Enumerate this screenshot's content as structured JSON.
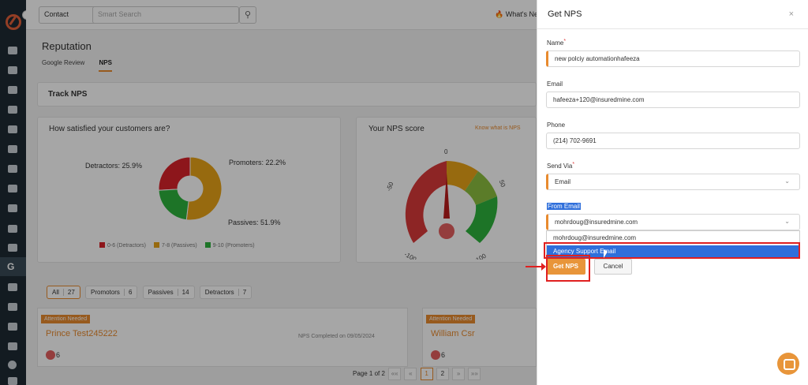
{
  "topbar": {
    "contact_select": "Contact",
    "search_placeholder": "Smart Search",
    "whats_new": "What's Ne"
  },
  "page": {
    "title": "Reputation",
    "tabs": [
      {
        "label": "Google Review",
        "active": false
      },
      {
        "label": "NPS",
        "active": true
      }
    ]
  },
  "track": {
    "title": "Track NPS"
  },
  "satisfaction": {
    "title": "How satisfied your customers are?",
    "legend": [
      {
        "label": "0-6 (Detractors)",
        "color": "#d9232a"
      },
      {
        "label": "7-8 (Passives)",
        "color": "#e8a317"
      },
      {
        "label": "9-10 (Promoters)",
        "color": "#2db33c"
      }
    ]
  },
  "chart_data": {
    "type": "pie",
    "title": "How satisfied your customers are?",
    "categories": [
      "Detractors",
      "Passives",
      "Promoters"
    ],
    "values": [
      25.9,
      51.9,
      22.2
    ],
    "labels": [
      "Detractors: 25.9%",
      "Passives: 51.9%",
      "Promoters: 22.2%"
    ],
    "colors": [
      "#d9232a",
      "#e8a317",
      "#2db33c"
    ]
  },
  "nps_score": {
    "title": "Your NPS score",
    "know_link": "Know what is NPS",
    "value": "-4",
    "ticks": [
      "-100",
      "-50",
      "0",
      "50",
      "100"
    ],
    "segments": [
      "Needs Improvement",
      "Good",
      "Great",
      "Excellent"
    ]
  },
  "filters": [
    {
      "label": "All",
      "count": "27",
      "active": true
    },
    {
      "label": "Promotors",
      "count": "6",
      "active": false
    },
    {
      "label": "Passives",
      "count": "14",
      "active": false
    },
    {
      "label": "Detractors",
      "count": "7",
      "active": false
    }
  ],
  "attention_cards": [
    {
      "badge": "Attention Needed",
      "name": "Prince Test245222",
      "count": "6",
      "completed": "NPS Completed on 09/05/2024"
    },
    {
      "badge": "Attention Needed",
      "name": "William Csr",
      "count": "6",
      "completed": ""
    }
  ],
  "pagination": {
    "text": "Page 1 of 2",
    "first": "««",
    "prev": "«",
    "pages": [
      "1",
      "2"
    ],
    "next": "»",
    "last": "»»"
  },
  "drawer": {
    "title": "Get NPS",
    "close": "×",
    "name_label": "Name",
    "name_value": "new polciy automationhafeeza",
    "email_label": "Email",
    "email_value": "hafeeza+120@insuredmine.com",
    "phone_label": "Phone",
    "phone_value": "(214) 702-9691",
    "send_via_label": "Send Via",
    "send_via_value": "Email",
    "from_email_label": "From Email",
    "from_email_value": "mohrdoug@insuredmine.com",
    "options": [
      "mohrdoug@insuredmine.com",
      "Agency Support Email"
    ],
    "get_nps": "Get NPS",
    "cancel": "Cancel"
  }
}
